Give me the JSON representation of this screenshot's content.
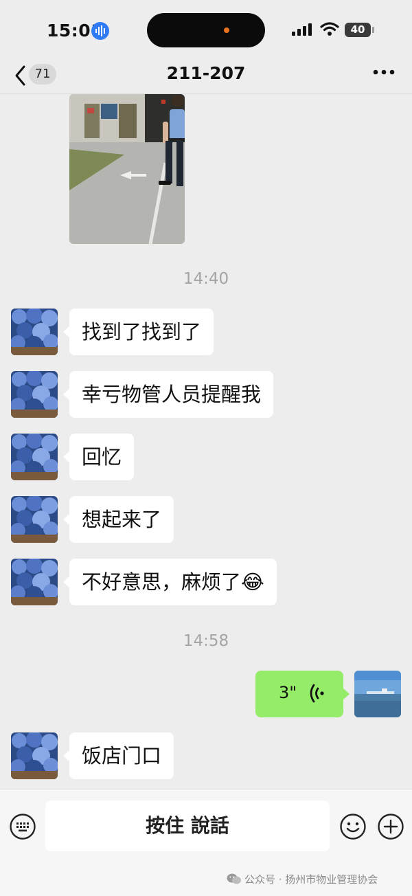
{
  "status_bar": {
    "time": "15:01",
    "battery": "40"
  },
  "header": {
    "back_badge": "71",
    "title": "211-207"
  },
  "messages": {
    "timestamp_1": "14:40",
    "texts": [
      "找到了找到了",
      "幸亏物管人员提醒我",
      "回忆",
      "想起来了",
      "不好意思，麻烦了😂"
    ],
    "timestamp_2": "14:58",
    "voice_duration": "3\"",
    "last_text": "饭店门口"
  },
  "input_bar": {
    "hold_to_talk": "按住 說話"
  },
  "watermark": "公众号 · 扬州市物业管理协会",
  "colors": {
    "self_bubble": "#95ec69",
    "background": "#ededed",
    "accent_mic": "#2f7bf6"
  }
}
